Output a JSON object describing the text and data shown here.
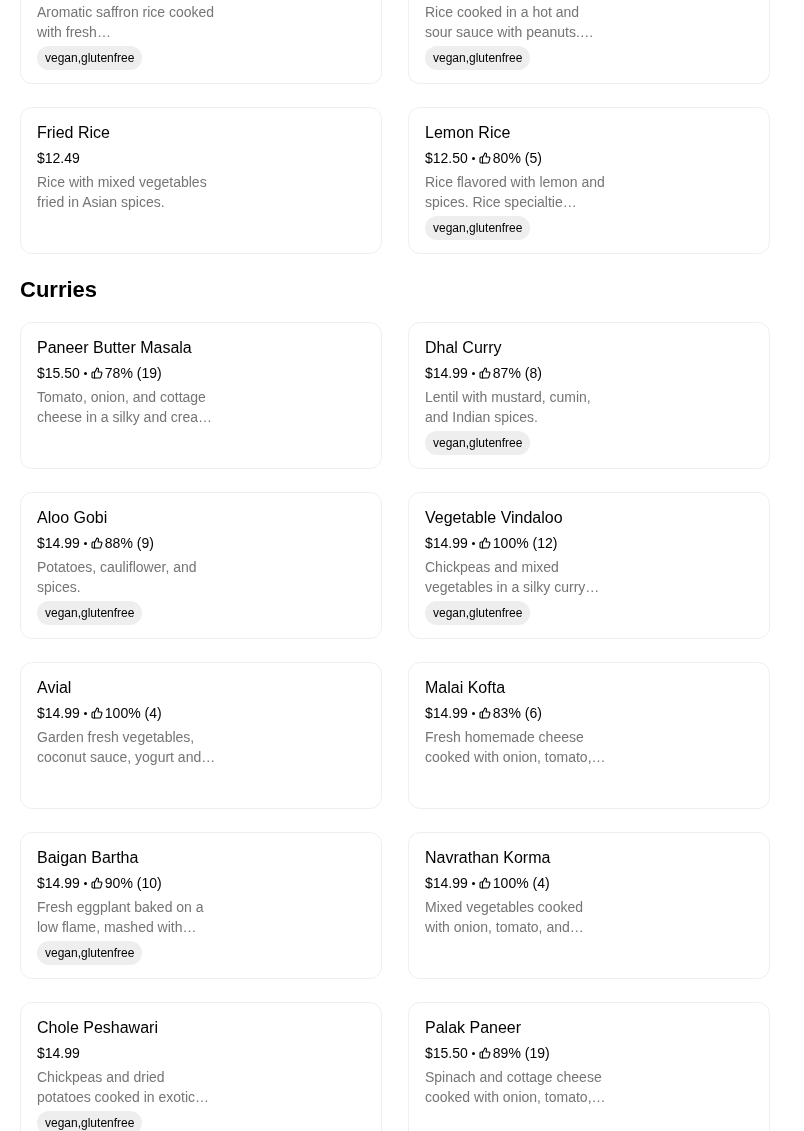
{
  "sections": [
    {
      "items": [
        {
          "description": "Aromatic saffron rice cooked with fresh…",
          "tag": "vegan,glutenfree"
        },
        {
          "description": "Rice cooked in a hot and sour sauce with peanuts.…",
          "tag": "vegan,glutenfree"
        },
        {
          "name": "Fried Rice",
          "price": "$12.49",
          "description": "Rice with mixed vegetables fried in Asian spices."
        },
        {
          "name": "Lemon Rice",
          "price": "$12.50",
          "rating": "80% (5)",
          "description": "Rice flavored with lemon and spices. Rice specialtie…",
          "tag": "vegan,glutenfree"
        }
      ]
    },
    {
      "title": "Curries",
      "items": [
        {
          "name": "Paneer Butter Masala",
          "price": "$15.50",
          "rating": "78% (19)",
          "description": "Tomato, onion, and cottage cheese in a silky and crea…"
        },
        {
          "name": "Dhal Curry",
          "price": "$14.99",
          "rating": "87% (8)",
          "description": "Lentil with mustard, cumin, and Indian spices.",
          "tag": "vegan,glutenfree"
        },
        {
          "name": "Aloo Gobi",
          "price": "$14.99",
          "rating": "88% (9)",
          "description": "Potatoes, cauliflower, and spices.",
          "tag": "vegan,glutenfree"
        },
        {
          "name": "Vegetable Vindaloo",
          "price": "$14.99",
          "rating": "100% (12)",
          "description": "Chickpeas and mixed vegetables in a silky curry…",
          "tag": "vegan,glutenfree"
        },
        {
          "name": "Avial",
          "price": "$14.99",
          "rating": "100% (4)",
          "description": "Garden fresh vegetables, coconut sauce, yogurt and…"
        },
        {
          "name": "Malai Kofta",
          "price": "$14.99",
          "rating": "83% (6)",
          "description": "Fresh homemade cheese cooked with onion, tomato,…"
        },
        {
          "name": "Baigan Bartha",
          "price": "$14.99",
          "rating": "90% (10)",
          "description": "Fresh eggplant baked on a low flame, mashed with…",
          "tag": "vegan,glutenfree"
        },
        {
          "name": "Navrathan Korma",
          "price": "$14.99",
          "rating": "100% (4)",
          "description": "Mixed vegetables cooked with onion, tomato, and…"
        },
        {
          "name": "Chole Peshawari",
          "price": "$14.99",
          "description": "Chickpeas and dried potatoes cooked in exotic…",
          "tag": "vegan,glutenfree"
        },
        {
          "name": "Palak Paneer",
          "price": "$15.50",
          "rating": "89% (19)",
          "description": "Spinach and cottage cheese cooked with onion, tomato,…"
        }
      ]
    }
  ]
}
